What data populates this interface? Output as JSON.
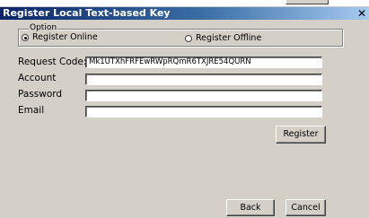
{
  "window": {
    "title": "Register Local Text-based Key",
    "close_glyph": "✕"
  },
  "option_group": {
    "legend": "Option",
    "register_online_label": "Register Online",
    "register_offline_label": "Register Offline",
    "selected": "register_online"
  },
  "form": {
    "request_code_label": "Request Code:",
    "request_code_value": "Mk1UTXhFRFEwRWpRQmR6TXJRE54QURN",
    "account_label": "Account",
    "account_value": "",
    "password_label": "Password",
    "password_value": "",
    "email_label": "Email",
    "email_value": ""
  },
  "buttons": {
    "register_label": "Register",
    "back_label": "Back",
    "cancel_label": "Cancel"
  }
}
